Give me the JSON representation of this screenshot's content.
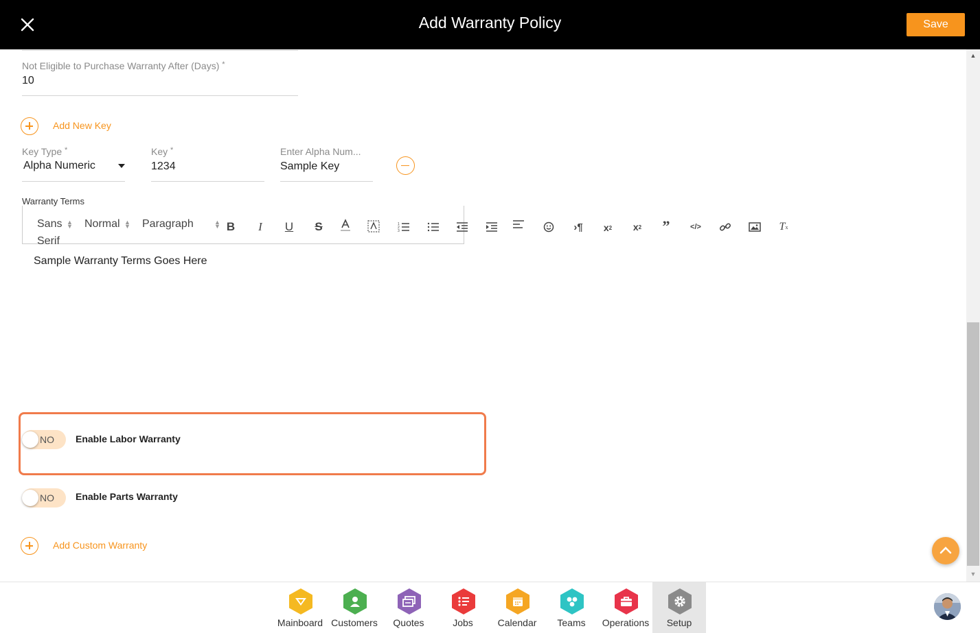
{
  "header": {
    "title": "Add Warranty Policy",
    "save_label": "Save"
  },
  "form": {
    "not_eligible": {
      "label": "Not Eligible to Purchase Warranty After (Days)",
      "required": "*",
      "value": "10"
    },
    "add_new_key_label": "Add New Key",
    "key_type": {
      "label": "Key Type",
      "required": "*",
      "value": "Alpha Numeric"
    },
    "key": {
      "label": "Key",
      "required": "*",
      "value": "1234"
    },
    "alpha_num": {
      "label": "Enter Alpha Num...",
      "value": "Sample Key"
    },
    "warranty_terms": {
      "label": "Warranty Terms",
      "font_family_line1": "Sans",
      "font_family_line2": "Serif",
      "font_size": "Normal",
      "block_format": "Paragraph",
      "content": "Sample Warranty Terms Goes Here"
    },
    "labor_warranty": {
      "toggle_text": "NO",
      "label": "Enable Labor Warranty"
    },
    "parts_warranty": {
      "toggle_text": "NO",
      "label": "Enable Parts Warranty"
    },
    "add_custom_warranty_label": "Add Custom Warranty"
  },
  "nav": {
    "items": [
      {
        "label": "Mainboard",
        "icon": "mainboard-icon",
        "color": "#f5b921"
      },
      {
        "label": "Customers",
        "icon": "customers-icon",
        "color": "#4caf50"
      },
      {
        "label": "Quotes",
        "icon": "quotes-icon",
        "color": "#8e63b7"
      },
      {
        "label": "Jobs",
        "icon": "jobs-icon",
        "color": "#ea3b3b"
      },
      {
        "label": "Calendar",
        "icon": "calendar-icon",
        "color": "#f5a623"
      },
      {
        "label": "Teams",
        "icon": "teams-icon",
        "color": "#2ec4c4"
      },
      {
        "label": "Operations",
        "icon": "operations-icon",
        "color": "#e8344a"
      },
      {
        "label": "Setup",
        "icon": "setup-icon",
        "color": "#8a8a8a",
        "active": true
      }
    ]
  },
  "colors": {
    "accent": "#f7941d",
    "header_bg": "#000000",
    "highlight": "#f07b4b"
  }
}
